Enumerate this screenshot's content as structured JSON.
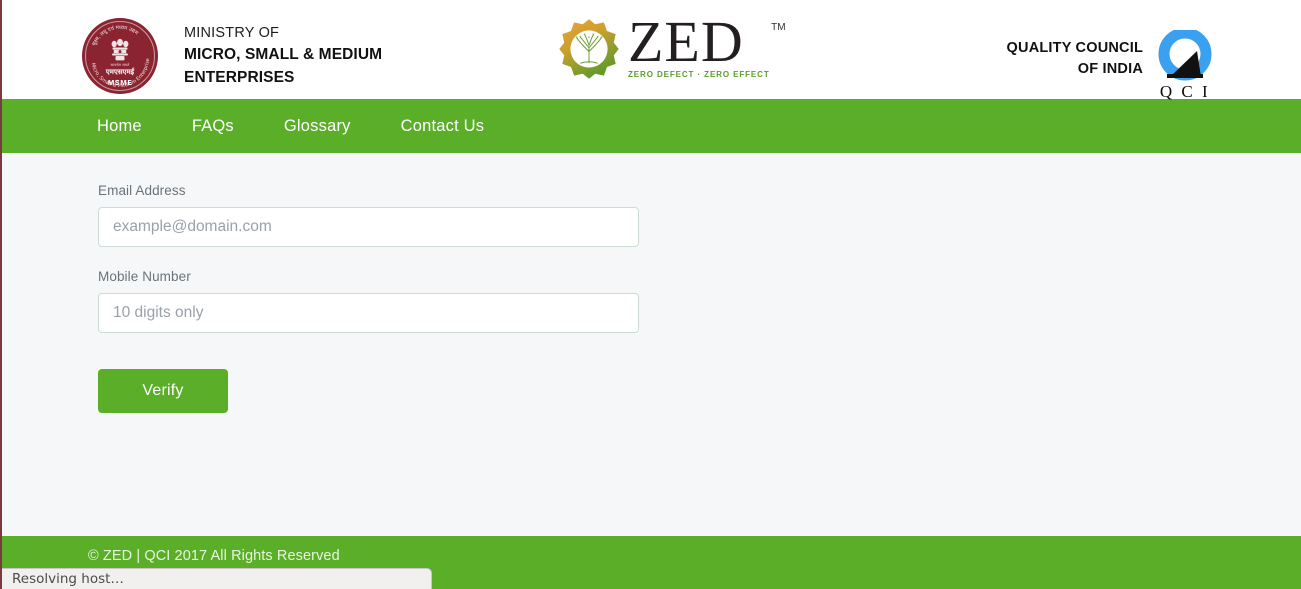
{
  "header": {
    "ministry": {
      "emblem_name": "msme-emblem",
      "line1": "MINISTRY OF",
      "line2": "MICRO, SMALL & MEDIUM",
      "line3": "ENTERPRISES",
      "emblem_hindi": "सत्यमेव जयते",
      "emblem_abbr": "MSME"
    },
    "zed": {
      "wordmark": "ZED",
      "trademark": "TM",
      "tagline": "ZERO DEFECT · ZERO EFFECT",
      "gear_color_start": "#e8962e",
      "gear_color_end": "#6aa32b"
    },
    "qci": {
      "line1": "QUALITY COUNCIL",
      "line2": "OF INDIA",
      "letters": "Q C I",
      "ring_color": "#2f9ceb"
    }
  },
  "nav": {
    "items": [
      {
        "label": "Home"
      },
      {
        "label": "FAQs"
      },
      {
        "label": "Glossary"
      },
      {
        "label": "Contact Us"
      }
    ],
    "background": "#5bae28"
  },
  "form": {
    "email": {
      "label": "Email Address",
      "placeholder": "example@domain.com",
      "value": ""
    },
    "mobile": {
      "label": "Mobile Number",
      "placeholder": "10 digits only",
      "value": ""
    },
    "submit_label": "Verify"
  },
  "footer": {
    "copyright": "© ZED | QCI 2017 All Rights Reserved"
  },
  "status_bar": {
    "message": "Resolving host…"
  }
}
